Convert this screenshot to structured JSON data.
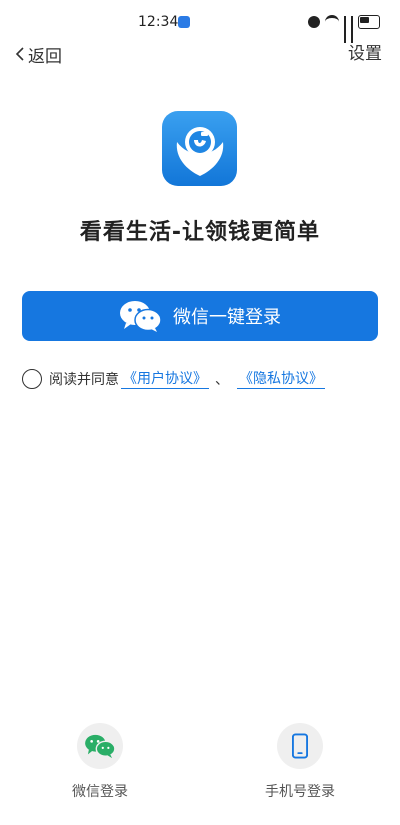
{
  "status_bar": {
    "time": "12:34",
    "icons": [
      "app-notification-icon",
      "alarm-icon",
      "wifi-icon",
      "signal-icon",
      "signal-icon",
      "battery-icon"
    ]
  },
  "nav": {
    "back_label": "返回",
    "settings_label": "设置"
  },
  "app": {
    "logo_icon": "app-logo-icon",
    "title": "看看生活-让领钱更简单"
  },
  "login": {
    "wechat_button_label": "微信一键登录",
    "wechat_icon": "wechat-icon"
  },
  "agreement": {
    "prefix": "阅读并同意",
    "user_agreement": "《用户协议》",
    "separator": "、",
    "privacy_policy": "《隐私协议》"
  },
  "alt_login": {
    "wechat_label": "微信登录",
    "phone_label": "手机号登录"
  },
  "colors": {
    "accent": "#1677e0",
    "wechat_green": "#2aae67"
  }
}
